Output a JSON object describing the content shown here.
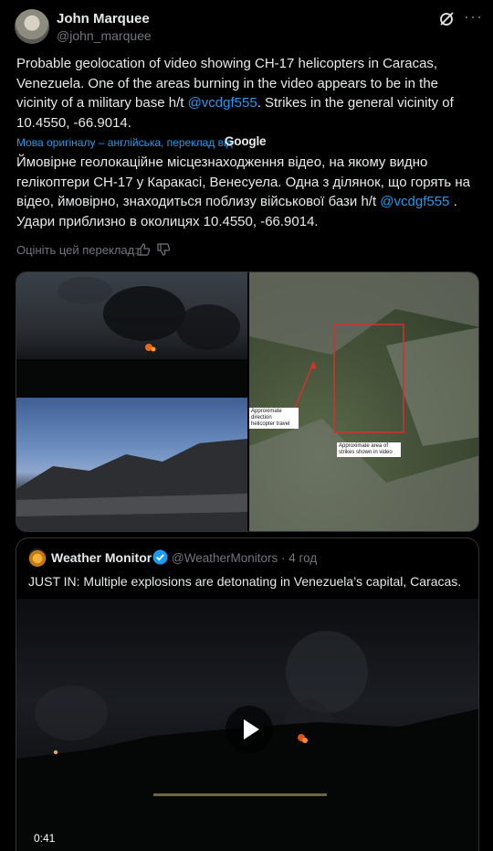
{
  "author": {
    "name": "John Marquee",
    "handle": "@john_marquee"
  },
  "post": {
    "text_before_mention": "Probable geolocation of video showing CH-17 helicopters in Caracas, Venezuela. One of the areas burning in the video appears to be in the vicinity of a military base h/t ",
    "mention": "@vcdgf555",
    "text_after_mention": ". Strikes in the general vicinity of 10.4550, -66.9014."
  },
  "translation": {
    "label": "Мова оригіналу – англійська, переклад від",
    "provider": "Google",
    "text_before_mention": "Ймовірне геолокаційне місцезнаходження відео, на якому видно гелікоптери CH-17 у Каракасі, Венесуела. Одна з ділянок, що горять на відео, ймовірно, знаходиться поблизу військової бази h/t ",
    "mention": "@vcdgf555",
    "text_after_mention": " . Удари приблизно в околицях 10.4550, -66.9014.",
    "rate_label": "Оцініть цей переклад:"
  },
  "map_labels": {
    "direction": "Approximate direction helicopter travel",
    "strikes": "Approximate area of strikes shown in video"
  },
  "quoted": {
    "name": "Weather Monitor",
    "handle": "@WeatherMonitors",
    "time": "· 4 год",
    "text": "JUST IN: Multiple explosions are detonating in Venezuela’s capital, Caracas.",
    "duration": "0:41"
  },
  "colors": {
    "accent": "#1d9bf0",
    "muted": "#71767b",
    "text": "#e7e9ea",
    "border": "#2f3336"
  }
}
